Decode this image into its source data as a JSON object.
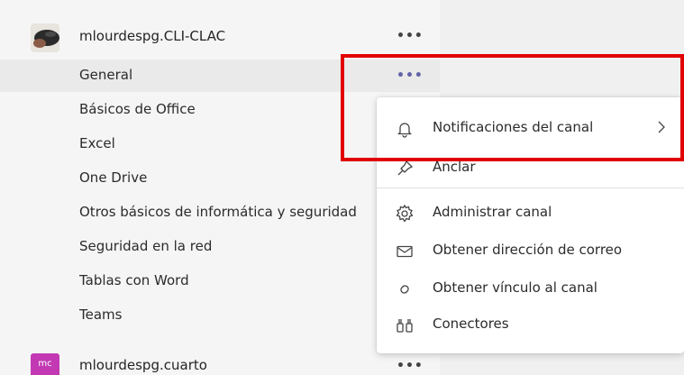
{
  "teams": [
    {
      "name": "mlourdespg.CLI-CLAC",
      "more": "•••"
    },
    {
      "name": "mlourdespg.cuarto",
      "initials": "mc",
      "more": "•••",
      "avatar_color": "#c239b3"
    }
  ],
  "channels": [
    {
      "label": "General",
      "selected": true,
      "more": "•••"
    },
    {
      "label": "Básicos de Office"
    },
    {
      "label": "Excel"
    },
    {
      "label": "One Drive"
    },
    {
      "label": "Otros básicos de informática y seguridad"
    },
    {
      "label": "Seguridad en la red"
    },
    {
      "label": "Tablas con Word"
    },
    {
      "label": "Teams"
    }
  ],
  "context_menu": {
    "items": [
      {
        "label": "Notificaciones del canal",
        "icon": "bell-icon",
        "has_submenu": true
      },
      {
        "label": "Anclar",
        "icon": "pin-icon"
      },
      {
        "label": "Administrar canal",
        "icon": "gear-icon"
      },
      {
        "label": "Obtener dirección de correo",
        "icon": "mail-icon"
      },
      {
        "label": "Obtener vínculo al canal",
        "icon": "link-icon"
      },
      {
        "label": "Conectores",
        "icon": "connectors-icon"
      }
    ]
  },
  "colors": {
    "accent": "#6264a7",
    "highlight": "#e00000",
    "sidebar_bg": "#f5f5f5",
    "selected_bg": "#eaeaea"
  }
}
